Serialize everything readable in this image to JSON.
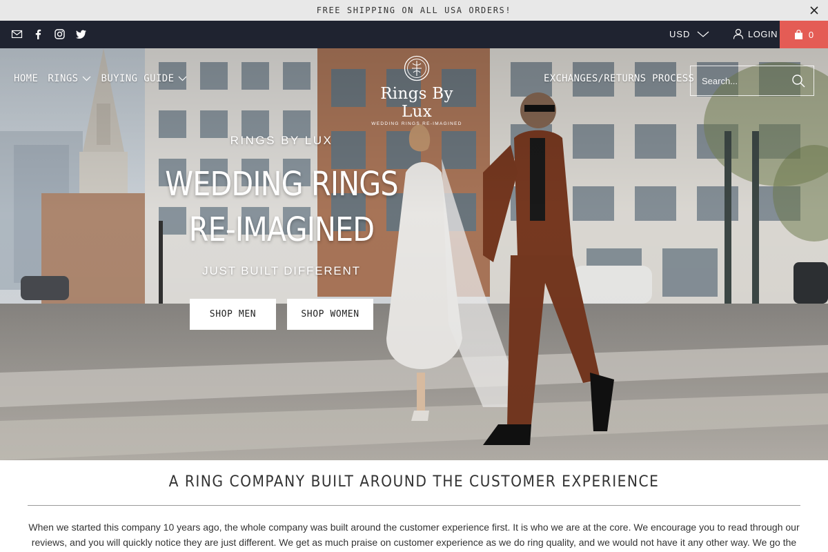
{
  "announcement": {
    "text": "FREE SHIPPING ON ALL USA ORDERS!",
    "close_icon": "close-icon"
  },
  "topbar": {
    "social_icons": [
      "email-icon",
      "facebook-icon",
      "instagram-icon",
      "twitter-icon"
    ],
    "currency": "USD",
    "login": "LOGIN",
    "cart_count": "0"
  },
  "nav": {
    "home": "HOME",
    "rings": "RINGS",
    "buying_guide": "BUYING GUIDE",
    "exchanges": "EXCHANGES/RETURNS PROCESS"
  },
  "logo": {
    "name": "Rings By Lux",
    "tagline": "WEDDING RINGS RE-IMAGINED"
  },
  "search": {
    "placeholder": "Search..."
  },
  "hero": {
    "subheading": "RINGS BY LUX",
    "title": "WEDDING RINGS RE-IMAGINED",
    "tagline": "JUST BUILT DIFFERENT",
    "button_men": "SHOP MEN",
    "button_women": "SHOP WOMEN"
  },
  "section": {
    "title": "A RING COMPANY BUILT AROUND THE CUSTOMER EXPERIENCE",
    "body": "When we started this company 10 years ago, the whole company was built around the customer experience first. It is who we are at the core. We encourage you to read through our reviews, and you will quickly notice they are just different. We get as much praise on customer experience as we do ring quality, and we would not have it any other way. We go the"
  },
  "colors": {
    "topbar": "#1f2330",
    "cart": "#e45c55",
    "announcement_bg": "#e8e8e8"
  }
}
